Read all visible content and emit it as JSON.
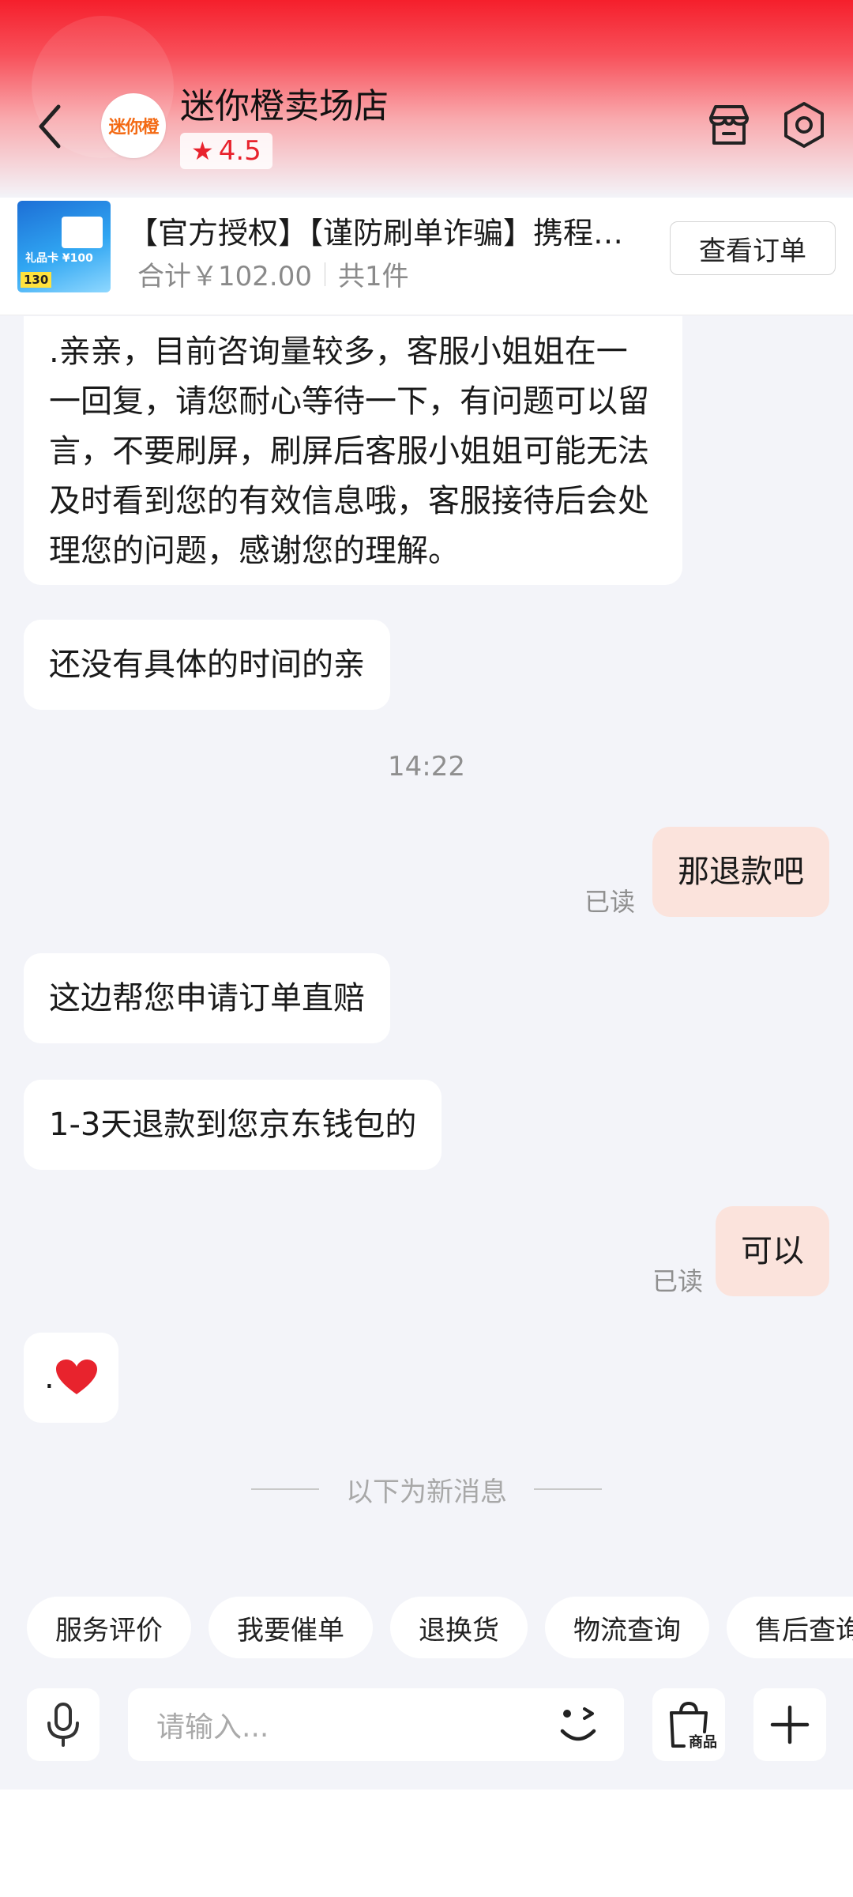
{
  "header": {
    "shop_name": "迷你橙卖场店",
    "avatar_text": "迷你橙",
    "rating": "4.5",
    "icons": [
      "back-icon",
      "store-icon",
      "settings-icon"
    ]
  },
  "order": {
    "title": "【官方授权】【谨防刷单诈骗】携程…",
    "total": "合计￥102.00",
    "count": "共1件",
    "view_button": "查看订单",
    "thumb_label": "礼品卡 ¥100",
    "thumb_badge": "130"
  },
  "messages": [
    {
      "side": "left",
      "text": ".亲亲，目前咨询量较多，客服小姐姐在一一回复，请您耐心等待一下，有问题可以留言，不要刷屏，刷屏后客服小姐姐可能无法及时看到您的有效信息哦，客服接待后会处理您的问题，感谢您的理解。"
    },
    {
      "side": "left",
      "text": "还没有具体的时间的亲"
    },
    {
      "type": "time",
      "text": "14:22"
    },
    {
      "side": "right",
      "text": "那退款吧",
      "status": "已读"
    },
    {
      "side": "left",
      "text": "这边帮您申请订单直赔"
    },
    {
      "side": "left",
      "text": "1-3天退款到您京东钱包的"
    },
    {
      "side": "right",
      "text": "可以",
      "status": "已读"
    },
    {
      "side": "left",
      "text": ".",
      "emoji": "heart-icon"
    }
  ],
  "new_messages_divider": "以下为新消息",
  "quick_actions": [
    "服务评价",
    "我要催单",
    "退换货",
    "物流查询",
    "售后查询"
  ],
  "input": {
    "placeholder": "请输入...",
    "product_button_label": "商品"
  },
  "colors": {
    "brand_red": "#f51f2c",
    "my_bubble": "#fbe3dc",
    "heart": "#e8232d"
  }
}
